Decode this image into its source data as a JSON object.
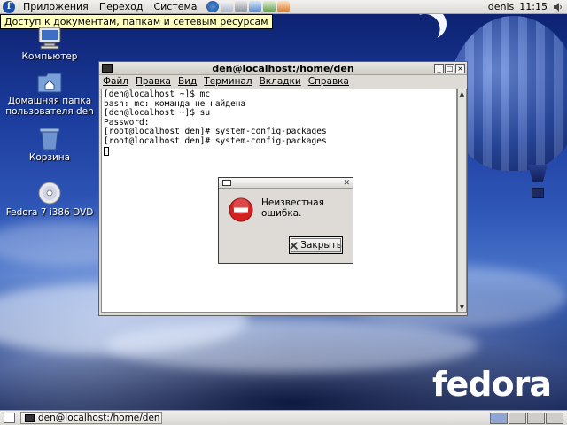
{
  "top_panel": {
    "menus": [
      "Приложения",
      "Переход",
      "Система"
    ],
    "user": "denis",
    "clock": "11:15"
  },
  "tooltip": "Доступ к документам, папкам и сетевым ресурсам",
  "desktop_icons": [
    {
      "label": "Компьютер"
    },
    {
      "label": "Домашняя папка пользователя den"
    },
    {
      "label": "Корзина"
    },
    {
      "label": "Fedora 7 i386 DVD"
    }
  ],
  "terminal": {
    "title": "den@localhost:/home/den",
    "menus": [
      "Файл",
      "Правка",
      "Вид",
      "Терминал",
      "Вкладки",
      "Справка"
    ],
    "lines": [
      "[den@localhost ~]$ mc",
      "bash: mc: команда не найдена",
      "[den@localhost ~]$ su",
      "Password:",
      "[root@localhost den]# system-config-packages",
      "[root@localhost den]# system-config-packages"
    ]
  },
  "dialog": {
    "message": "Неизвестная ошибка.",
    "button_label": "Закрыть"
  },
  "taskbar": {
    "task_title": "den@localhost:/home/den"
  },
  "branding": {
    "logo_text": "fedora"
  },
  "colors": {
    "panel": "#dcdad5",
    "tooltip": "#ffffbf",
    "error_red": "#d42020",
    "desktop_blue": "#2f57b8"
  }
}
